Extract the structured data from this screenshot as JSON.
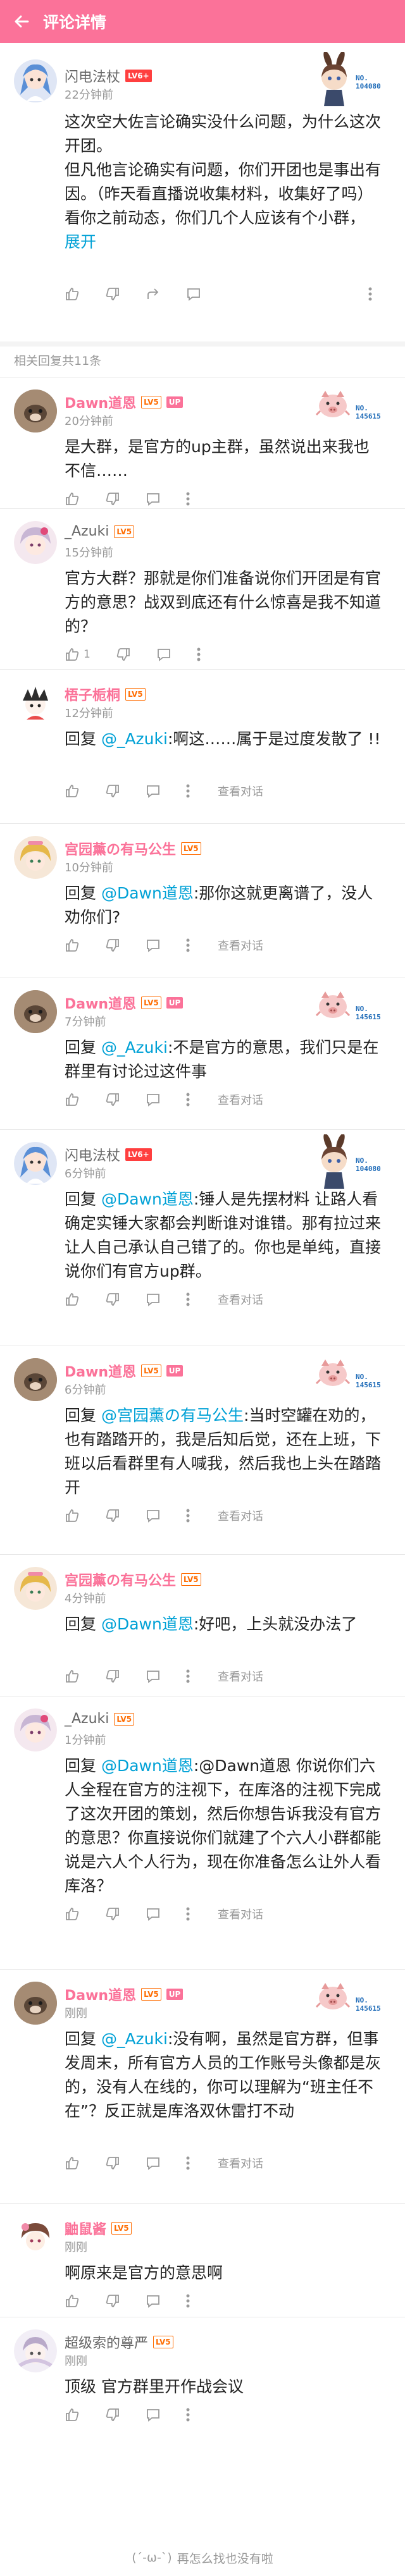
{
  "header": {
    "title": "评论详情"
  },
  "main_comment": {
    "username": "闪电法杖",
    "level": "LV6+",
    "time": "22分钟前",
    "badge_text": "NO. 104080",
    "lines": [
      "这次空大佐言论确实没什么问题，为什么这次开团。",
      "但凡他言论确实有问题，你们开团也是事出有因。（昨天看直播说收集材料，收集好了吗）",
      "看你之前动态，你们几个人应该有个小群，"
    ],
    "expand": "展开"
  },
  "replies_header": "相关回复共11条",
  "replies": [
    {
      "username": "Dawn道恩",
      "level": "LV5",
      "up": "UP",
      "time": "20分钟前",
      "badge": "NO. 145615",
      "prefix": "",
      "mention": "",
      "text": "是大群，是官方的up主群，虽然说出来我也不信……",
      "likes": "",
      "show_view": false
    },
    {
      "username": "_Azuki",
      "level": "LV5",
      "up": "",
      "time": "15分钟前",
      "badge": "",
      "prefix": "",
      "mention": "",
      "text": "官方大群？那就是你们准备说你们开团是有官方的意思？战双到底还有什么惊喜是我不知道的？",
      "likes": "1",
      "show_view": false
    },
    {
      "username": "梧子栀桐",
      "level": "LV5",
      "up": "",
      "time": "12分钟前",
      "badge": "",
      "prefix": "回复 ",
      "mention": "@_Azuki",
      "text": ":啊这……属于是过度发散了 !!",
      "likes": "",
      "show_view": true,
      "view_label": "查看对话"
    },
    {
      "username": "宫园薰の有马公生",
      "level": "LV5",
      "up": "",
      "time": "10分钟前",
      "badge": "",
      "prefix": "回复 ",
      "mention": "@Dawn道恩",
      "text": ":那你这就更离谱了，没人劝你们?",
      "likes": "",
      "show_view": true,
      "view_label": "查看对话"
    },
    {
      "username": "Dawn道恩",
      "level": "LV5",
      "up": "UP",
      "time": "7分钟前",
      "badge": "NO. 145615",
      "prefix": "回复 ",
      "mention": "@_Azuki",
      "text": ":不是官方的意思，我们只是在群里有讨论过这件事",
      "likes": "",
      "show_view": true,
      "view_label": "查看对话"
    },
    {
      "username": "闪电法杖",
      "level": "LV6+",
      "up": "",
      "time": "6分钟前",
      "badge": "NO. 104080",
      "prefix": "回复 ",
      "mention": "@Dawn道恩",
      "text": ":锤人是先摆材料 让路人看 确定实锤大家都会判断谁对谁错。那有拉过来让人自己承认自己错了的。你也是单纯，直接说你们有官方up群。",
      "likes": "",
      "show_view": true,
      "view_label": "查看对话"
    },
    {
      "username": "Dawn道恩",
      "level": "LV5",
      "up": "UP",
      "time": "6分钟前",
      "badge": "NO. 145615",
      "prefix": "回复 ",
      "mention": "@宫园薰の有马公生",
      "text": ":当时空罐在劝的，也有踏踏开的，我是后知后觉，还在上班，下班以后看群里有人喊我，然后我也上头在踏踏开",
      "likes": "",
      "show_view": true,
      "view_label": "查看对话"
    },
    {
      "username": "宫园薰の有马公生",
      "level": "LV5",
      "up": "",
      "time": "4分钟前",
      "badge": "",
      "prefix": "回复 ",
      "mention": "@Dawn道恩",
      "text": ":好吧，上头就没办法了",
      "likes": "",
      "show_view": true,
      "view_label": "查看对话"
    },
    {
      "username": "_Azuki",
      "level": "LV5",
      "up": "",
      "time": "1分钟前",
      "badge": "",
      "prefix": "回复 ",
      "mention": "@Dawn道恩",
      "text": ":@Dawn道恩 你说你们六人全程在官方的注视下，在库洛的注视下完成了这次开团的策划，然后你想告诉我没有官方的意思？你直接说你们就建了个六人小群都能说是六人个人行为，现在你准备怎么让外人看库洛？",
      "likes": "",
      "show_view": true,
      "view_label": "查看对话"
    },
    {
      "username": "Dawn道恩",
      "level": "LV5",
      "up": "UP",
      "time": "刚刚",
      "badge": "NO. 145615",
      "prefix": "回复 ",
      "mention": "@_Azuki",
      "text": ":没有啊，虽然是官方群，但事发周末，所有官方人员的工作账号头像都是灰的，没有人在线的，你可以理解为“班主任不在”？反正就是库洛双休雷打不动",
      "likes": "",
      "show_view": true,
      "view_label": "查看对话"
    },
    {
      "username": "鼬鼠酱",
      "level": "LV5",
      "up": "",
      "time": "刚刚",
      "badge": "",
      "prefix": "",
      "mention": "",
      "text": "啊原来是官方的意思啊",
      "likes": "",
      "show_view": false
    },
    {
      "username": "超级索的尊严",
      "level": "LV5",
      "up": "",
      "time": "刚刚",
      "badge": "",
      "prefix": "",
      "mention": "",
      "text": "顶级 官方群里开作战会议",
      "likes": "",
      "show_view": false
    }
  ],
  "footer": {
    "emote": "(´-ω-`)",
    "text": "再怎么找也没有啦"
  },
  "colors": {
    "brand": "#fb7299",
    "link": "#00a1d6"
  }
}
